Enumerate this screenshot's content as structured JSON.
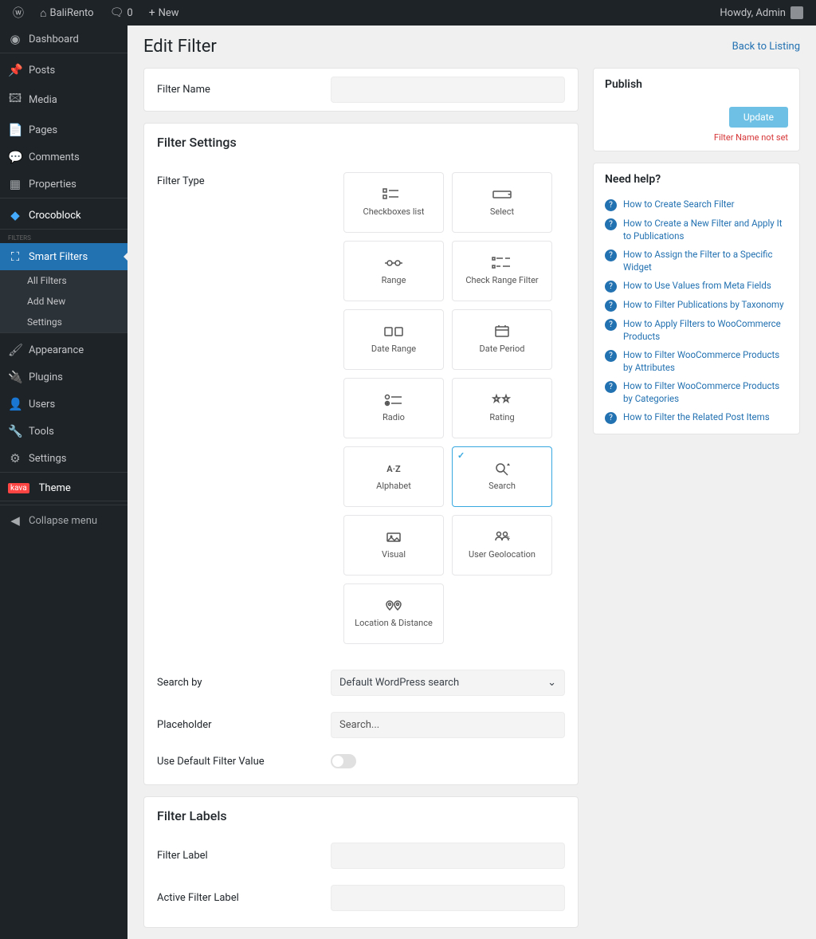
{
  "adminbar": {
    "site": "BaliRento",
    "comments": "0",
    "new": "New",
    "howdy": "Howdy, Admin"
  },
  "sidebar": {
    "dashboard": "Dashboard",
    "posts": "Posts",
    "media": "Media",
    "pages": "Pages",
    "comments": "Comments",
    "properties": "Properties",
    "crocoblock": "Crocoblock",
    "smartfilters": "Smart Filters",
    "sub_all": "All Filters",
    "sub_add": "Add New",
    "sub_settings": "Settings",
    "appearance": "Appearance",
    "plugins": "Plugins",
    "users": "Users",
    "tools": "Tools",
    "settings": "Settings",
    "theme_badge": "kava",
    "theme": "Theme",
    "collapse": "Collapse menu"
  },
  "page": {
    "title": "Edit Filter",
    "back": "Back to Listing"
  },
  "panel_name": {
    "label": "Filter Name"
  },
  "settings": {
    "title": "Filter Settings",
    "type_label": "Filter Type",
    "types": [
      "Checkboxes list",
      "Select",
      "Range",
      "Check Range Filter",
      "Date Range",
      "Date Period",
      "Radio",
      "Rating",
      "Alphabet",
      "Search",
      "Visual",
      "User Geolocation",
      "Location & Distance"
    ],
    "selected_index": 9,
    "searchby_label": "Search by",
    "searchby_value": "Default WordPress search",
    "placeholder_label": "Placeholder",
    "placeholder_value": "Search...",
    "default_label": "Use Default Filter Value"
  },
  "labels": {
    "title": "Filter Labels",
    "filter_label": "Filter Label",
    "active_label": "Active Filter Label"
  },
  "publish": {
    "title": "Publish",
    "update": "Update",
    "error": "Filter Name not set"
  },
  "help": {
    "title": "Need help?",
    "items": [
      "How to Create Search Filter",
      "How to Create a New Filter and Apply It to Publications",
      "How to Assign the Filter to a Specific Widget",
      "How to Use Values from Meta Fields",
      "How to Filter Publications by Taxonomy",
      "How to Apply Filters to WooCommerce Products",
      "How to Filter WooCommerce Products by Attributes",
      "How to Filter WooCommerce Products by Categories",
      "How to Filter the Related Post Items"
    ]
  }
}
